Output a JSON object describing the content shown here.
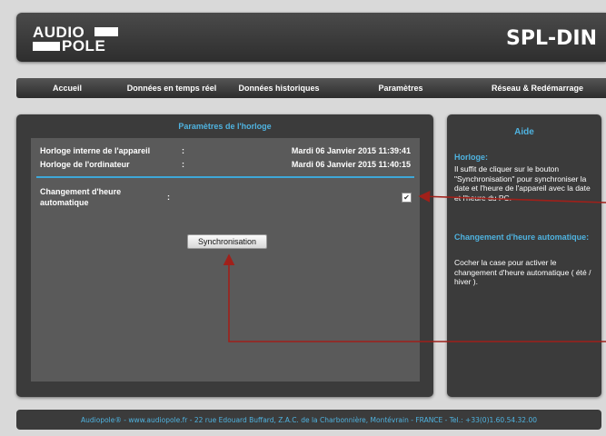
{
  "header": {
    "logo_line1": "AUDIO",
    "logo_line2": "POLE",
    "device_name": "SPL-DIN"
  },
  "nav": {
    "items": [
      "Accueil",
      "Données en temps réel",
      "Données historiques",
      "Paramètres",
      "Réseau & Redémarrage"
    ]
  },
  "clock": {
    "title": "Paramètres de l'horloge",
    "device_label": "Horloge interne de l'appareil",
    "device_value": "Mardi 06 Janvier 2015 11:39:41",
    "pc_label": "Horloge de l'ordinateur",
    "pc_value": "Mardi 06 Janvier 2015 11:40:15",
    "colon": ":",
    "auto_change_label_1": "Changement d'heure",
    "auto_change_label_2": "automatique",
    "auto_change_checked": true,
    "sync_button": "Synchronisation"
  },
  "help": {
    "title": "Aide",
    "sec1_title": "Horloge:",
    "sec1_text": "Il suffit de cliquer sur le bouton \"Synchronisation\" pour synchroniser la date et l'heure de l'appareil avec la date et l'heure du PC.",
    "sec2_title": "Changement d'heure automatique:",
    "sec2_text": "Cocher la case pour activer le changement d'heure automatique ( été / hiver )."
  },
  "footer": {
    "text": "Audiopole® - www.audiopole.fr - 22 rue Edouard Buffard, Z.A.C. de la Charbonnière, Montévrain - FRANCE - Tel.: +33(0)1.60.54.32.00"
  },
  "colors": {
    "accent": "#4fb3e0",
    "panel": "#3b3b3b",
    "arrow": "#a0201a"
  }
}
